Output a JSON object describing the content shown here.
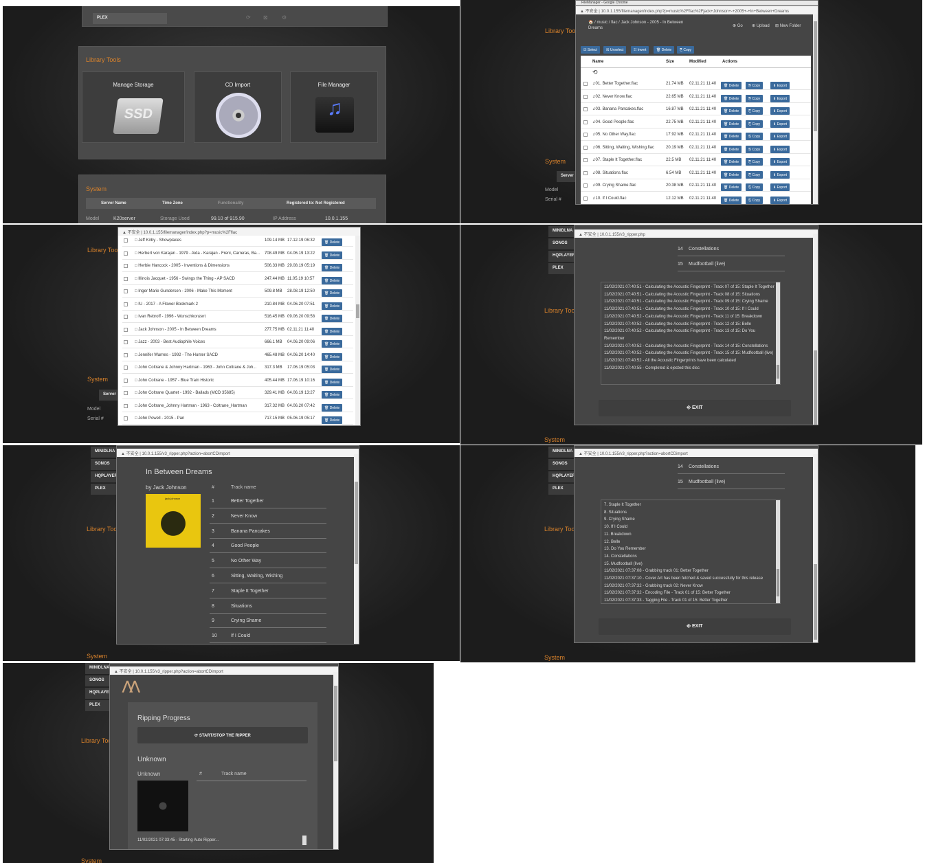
{
  "p1": {
    "side_plex": "PLEX",
    "tools_title": "Library Tools",
    "tools": [
      {
        "label": "Manage Storage",
        "icon": "ssd-icon",
        "icon_text": "SSD"
      },
      {
        "label": "CD Import",
        "icon": "cd-icon"
      },
      {
        "label": "File Manager",
        "icon": "music-folder-icon"
      }
    ],
    "system_title": "System",
    "headers": [
      "Server Name",
      "Time Zone",
      "Functionality",
      "Registered to: Not Registered"
    ],
    "model_label": "Model",
    "model_value": "K20server",
    "storage_label": "Storage Used",
    "storage_value": "99.10 of 915.90",
    "ip_label": "IP Address",
    "ip_value": "10.0.1.155"
  },
  "p2": {
    "window_title": "FileManager - Google Chrome",
    "address": "▲ 不安全 | 10.0.1.155/filemanager/index.php?p=music%2Fflac%2Fjack+Johnson+-+2005+-+In+Between+Dreams",
    "crumb": "🏠 / music / flac / Jack Johnson - 2005 - In Between Dreams",
    "go": "⊕ Go",
    "upload": "⊕ Upload",
    "new_folder": "⊞ New Folder",
    "toolbar": [
      "☑ Select",
      "☒ Unselect",
      "☷ Invert",
      "🗑 Delete",
      "⎘ Copy"
    ],
    "cols": [
      "Name",
      "Size",
      "Modified",
      "Actions"
    ],
    "actions": [
      "🗑 Delete",
      "⎘ Copy",
      "⬇ Export"
    ],
    "files": [
      {
        "name": "♫01. Better Together.flac",
        "size": "21.74 MB",
        "mod": "02.11.21 11:40"
      },
      {
        "name": "♫02. Never Know.flac",
        "size": "22.65 MB",
        "mod": "02.11.21 11:40"
      },
      {
        "name": "♫03. Banana Pancakes.flac",
        "size": "16.87 MB",
        "mod": "02.11.21 11:40"
      },
      {
        "name": "♫04. Good People.flac",
        "size": "22.75 MB",
        "mod": "02.11.21 11:40"
      },
      {
        "name": "♫05. No Other Way.flac",
        "size": "17.92 MB",
        "mod": "02.11.21 11:40"
      },
      {
        "name": "♫06. Sitting, Waiting, Wishing.flac",
        "size": "20.19 MB",
        "mod": "02.11.21 11:40"
      },
      {
        "name": "♫07. Staple It Together.flac",
        "size": "22.5 MB",
        "mod": "02.11.21 11:40"
      },
      {
        "name": "♫08. Situations.flac",
        "size": "6.54 MB",
        "mod": "02.11.21 11:40"
      },
      {
        "name": "♫09. Crying Shame.flac",
        "size": "20.38 MB",
        "mod": "02.11.21 11:40"
      },
      {
        "name": "♫10. If I Could.flac",
        "size": "12.12 MB",
        "mod": "02.11.21 11:40"
      }
    ],
    "bg_tools": "Library Tools",
    "bg_system": "System",
    "bg_server": "Server",
    "bg_model": "Model",
    "bg_serial": "Serial #"
  },
  "p3": {
    "address": "▲ 不安全 | 10.0.1.155/filemanager/index.php?p=music%2Fflac",
    "action": "🗑 Delete",
    "folders": [
      {
        "name": "□ Jeff Kirby - Showplaces",
        "size": "109.14 MB",
        "mod": "17.12.19 06:32"
      },
      {
        "name": "□ Herbert von Karajan - 1979 - Aida - Karajan - Freni, Carreras, Ba...",
        "size": "708.49 MB",
        "mod": "04.06.19 13:22"
      },
      {
        "name": "□ Herbie Hancock - 2005 - Inventions & Dimensions",
        "size": "506.33 MB",
        "mod": "29.08.19 05:19"
      },
      {
        "name": "□ Illinois Jacquet - 1956 - Swings the Thing - AP SACD",
        "size": "247.44 MB",
        "mod": "11.05.19 10:57"
      },
      {
        "name": "□ Inger Marie Gundersen - 2006 - Make This Moment",
        "size": "509.8 MB",
        "mod": "28.08.19 12:50"
      },
      {
        "name": "□ IU - 2017 - A Flower Bookmark 2",
        "size": "210.84 MB",
        "mod": "04.06.20 07:51"
      },
      {
        "name": "□ Ivan Rebroff - 1996 - Wunschkonzert",
        "size": "516.45 MB",
        "mod": "09.06.20 09:58"
      },
      {
        "name": "□ Jack Johnson - 2005 - In Between Dreams",
        "size": "277.75 MB",
        "mod": "02.11.21 11:40"
      },
      {
        "name": "□ Jazz - 2003 - Best Audiophile Voices",
        "size": "666.1 MB",
        "mod": "04.06.20 09:06"
      },
      {
        "name": "□ Jennifer Warnes - 1992 - The Hunter SACD",
        "size": "465.48 MB",
        "mod": "04.06.20 14:40"
      },
      {
        "name": "□ John Coltrane & Johnny Hartman - 1963 - John Coltrane & Joh...",
        "size": "317.3 MB",
        "mod": "17.06.19 05:03"
      },
      {
        "name": "□ John Coltrane - 1957 - Blue Train Historic",
        "size": "405.44 MB",
        "mod": "17.06.19 10:16"
      },
      {
        "name": "□ John Coltrane Quartet - 1992 - Ballads (MCD 35685)",
        "size": "329.41 MB",
        "mod": "04.06.19 13:27"
      },
      {
        "name": "□ John Coltrane_Johnny Hartman - 1963 - Coltrane_Hartman",
        "size": "317.32 MB",
        "mod": "04.06.20 07:42"
      },
      {
        "name": "□ John Powell - 2015 - Pan",
        "size": "717.15 MB",
        "mod": "05.06.19 05:17"
      }
    ],
    "bg_tools": "Library Too",
    "bg_system": "System",
    "bg_server": "Server",
    "bg_model": "Model",
    "bg_serial": "Serial #"
  },
  "p4": {
    "address": "▲ 不安全 | 10.0.1.155/v3_ripper.php",
    "side": [
      "MINIDLNA",
      "SONOS",
      "HQPLAYER",
      "PLEX"
    ],
    "tracks": [
      {
        "n": "14",
        "t": "Constellations"
      },
      {
        "n": "15",
        "t": "Mudfootball (live)"
      }
    ],
    "log": [
      "11/02/2021 07:40:51 - Calculating the Acoustic Fingerprint - Track 07 of 15: Staple It Together",
      "11/02/2021 07:40:51 - Calculating the Acoustic Fingerprint - Track 08 of 15: Situations",
      "11/02/2021 07:40:51 - Calculating the Acoustic Fingerprint - Track 09 of 15: Crying Shame",
      "11/02/2021 07:40:51 - Calculating the Acoustic Fingerprint - Track 10 of 15: If I Could",
      "11/02/2021 07:40:52 - Calculating the Acoustic Fingerprint - Track 11 of 15: Breakdown",
      "11/02/2021 07:40:52 - Calculating the Acoustic Fingerprint - Track 12 of 15: Belle",
      "11/02/2021 07:40:52 - Calculating the Acoustic Fingerprint - Track 13 of 15: Do You",
      "Remember",
      "11/02/2021 07:40:52 - Calculating the Acoustic Fingerprint - Track 14 of 15: Constellations",
      "11/02/2021 07:40:52 - Calculating the Acoustic Fingerprint - Track 15 of 15: Mudfootball (live)",
      "11/02/2021 07:40:52 - All the Acoustic Fingerprints have been calculated",
      "11/02/2021 07:40:55 - Completed & ejected this disc"
    ],
    "exit": "⎆ EXIT",
    "bg_tools": "Library Too",
    "bg_system": "System"
  },
  "p5": {
    "address": "▲ 不安全 | 10.0.1.155/v3_ripper.php?action=abortCDimport",
    "side": [
      "MINIDLNA",
      "SONOS",
      "HQPLAYER",
      "PLEX"
    ],
    "album": "In Between Dreams",
    "artist": "by Jack Johnson",
    "cover_text": "jack johnson",
    "col_num": "#",
    "col_name": "Track name",
    "tracks": [
      {
        "n": "1",
        "t": "Better Together"
      },
      {
        "n": "2",
        "t": "Never Know"
      },
      {
        "n": "3",
        "t": "Banana Pancakes"
      },
      {
        "n": "4",
        "t": "Good People"
      },
      {
        "n": "5",
        "t": "No Other Way"
      },
      {
        "n": "6",
        "t": "Sitting, Waiting, Wishing"
      },
      {
        "n": "7",
        "t": "Staple It Together"
      },
      {
        "n": "8",
        "t": "Situations"
      },
      {
        "n": "9",
        "t": "Crying Shame"
      },
      {
        "n": "10",
        "t": "If I Could"
      }
    ],
    "bg_tools": "Library Too",
    "bg_system": "System"
  },
  "p6": {
    "address": "▲ 不安全 | 10.0.1.155/v3_ripper.php?action=abortCDimport",
    "side": [
      "MINIDLNA",
      "SONOS",
      "HQPLAYER",
      "PLEX"
    ],
    "tracks": [
      {
        "n": "14",
        "t": "Constellations"
      },
      {
        "n": "15",
        "t": "Mudfootball (live)"
      }
    ],
    "log": [
      "7. Staple It Together",
      "8. Situations",
      "9. Crying Shame",
      "10. If I Could",
      "11. Breakdown",
      "12. Belle",
      "13. Do You Remember",
      "14. Constellations",
      "15. Mudfootball (live)",
      "11/02/2021 07:37:08 - Grabbing track 01: Better Together",
      "11/02/2021 07:37:10 - Cover Art has been fetched & saved successfully for this release",
      "11/02/2021 07:37:32 - Grabbing track 02: Never Know",
      "11/02/2021 07:37:32 - Encoding File - Track 01 of 15: Better Together",
      "11/02/2021 07:37:33 - Tagging File - Track 01 of 15: Better Together"
    ],
    "exit": "⎆ EXIT",
    "bg_tools": "Library Too",
    "bg_system": "System"
  },
  "p7": {
    "address": "▲ 不安全 | 10.0.1.155/v3_ripper.php?action=abortCDimport",
    "side": [
      "MINIDLNA",
      "SONOS",
      "HQPLAYER",
      "PLEX"
    ],
    "progress_title": "Ripping Progress",
    "start_stop": "⟳ START/STOP THE RIPPER",
    "album": "Unknown",
    "artist": "Unknown",
    "col_num": "#",
    "col_name": "Track name",
    "log": [
      "11/02/2021 07:33:45 - Starting Auto Ripper..."
    ],
    "bg_tools": "Library Too",
    "bg_system": "System"
  },
  "colors": {
    "accent": "#d9822b",
    "button_blue": "#3a6a9c",
    "panel": "#454545"
  }
}
